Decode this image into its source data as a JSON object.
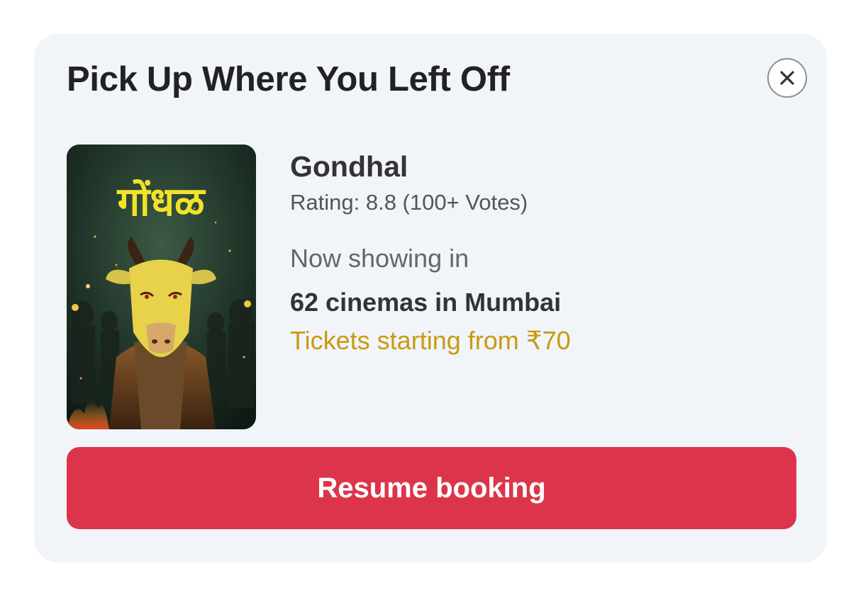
{
  "card": {
    "title": "Pick Up Where You Left Off",
    "close_icon": "close-icon"
  },
  "movie": {
    "poster_icon": "movie-poster",
    "poster_title": "गोंधळ",
    "title": "Gondhal",
    "rating": "Rating: 8.8 (100+ Votes)",
    "showing_label": "Now showing in",
    "cinemas": "62 cinemas in Mumbai",
    "price": "Tickets starting from ₹70"
  },
  "actions": {
    "resume_label": "Resume booking"
  },
  "colors": {
    "card_background": "#f1f4f9",
    "button": "#dc354b",
    "price_text": "#c99a0f"
  }
}
